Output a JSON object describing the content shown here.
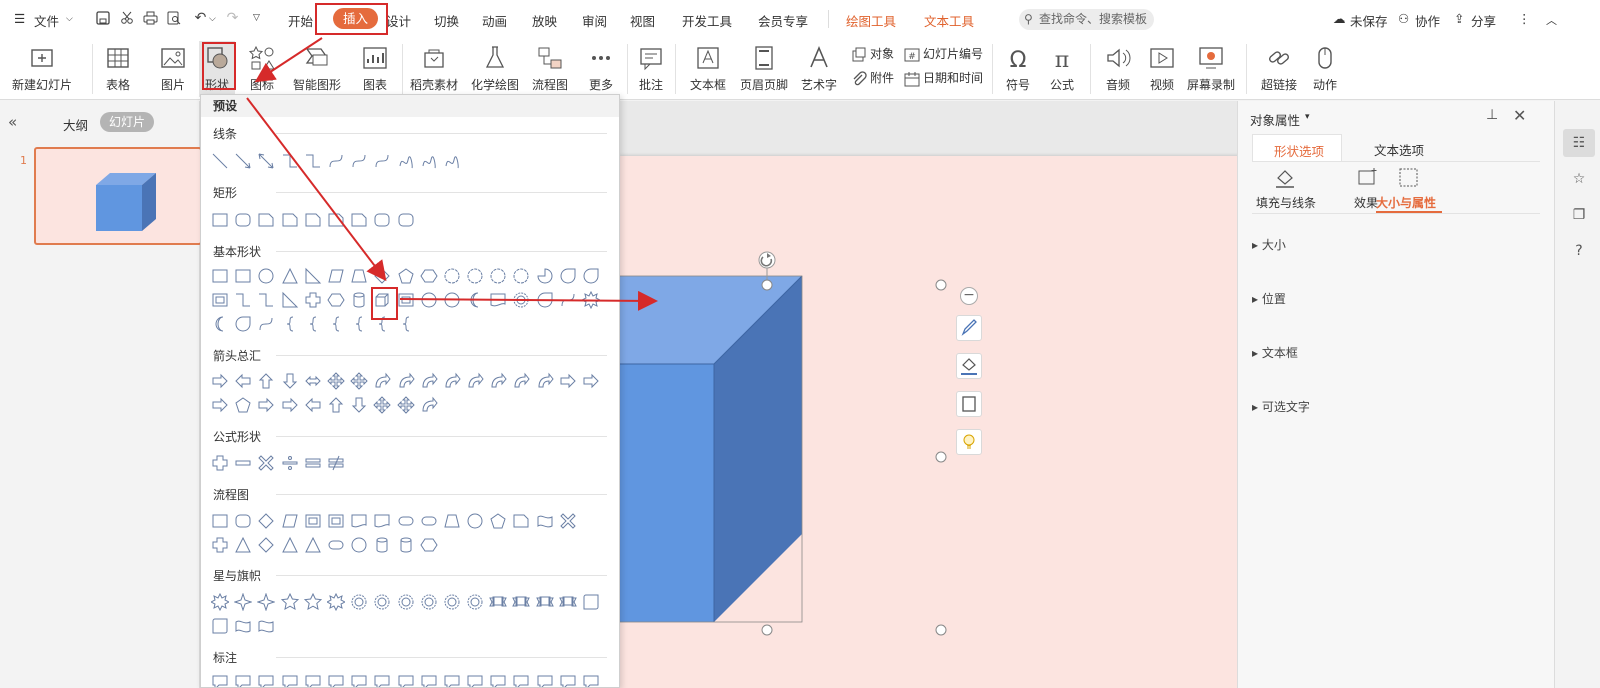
{
  "menubar": {
    "file": "文件",
    "tabs": [
      "开始",
      "插入",
      "设计",
      "切换",
      "动画",
      "放映",
      "审阅",
      "视图",
      "开发工具",
      "会员专享"
    ],
    "context_tabs": [
      "绘图工具",
      "文本工具"
    ],
    "search_placeholder": "查找命令、搜索模板",
    "unsaved": "未保存",
    "collab": "协作",
    "share": "分享"
  },
  "ribbon": {
    "new_slide": "新建幻灯片",
    "table": "表格",
    "picture": "图片",
    "shape": "形状",
    "icon": "图标",
    "smartart": "智能图形",
    "chart": "图表",
    "material": "稻壳素材",
    "chem": "化学绘图",
    "flowchart": "流程图",
    "more": "更多",
    "comment": "批注",
    "textbox": "文本框",
    "header_footer": "页眉页脚",
    "wordart": "艺术字",
    "object": "对象",
    "attachment": "附件",
    "slide_number": "幻灯片编号",
    "datetime": "日期和时间",
    "symbol": "符号",
    "formula": "公式",
    "audio": "音频",
    "video": "视频",
    "screen_record": "屏幕录制",
    "hyperlink": "超链接",
    "action": "动作"
  },
  "leftpanel": {
    "outline": "大纲",
    "slides": "幻灯片",
    "slide_num": "1"
  },
  "dropdown": {
    "header": "预设",
    "sections": [
      "线条",
      "矩形",
      "基本形状",
      "箭头总汇",
      "公式形状",
      "流程图",
      "星与旗帜",
      "标注"
    ]
  },
  "rightpanel": {
    "title": "对象属性",
    "tab_shape": "形状选项",
    "tab_text": "文本选项",
    "sub_fill": "填充与线条",
    "sub_effect": "效果",
    "sub_size": "大小与属性",
    "items": [
      "大小",
      "位置",
      "文本框",
      "可选文字"
    ]
  },
  "colors": {
    "accent": "#e56b3d",
    "cube_front": "#6096e0",
    "cube_top": "#7fa8e6",
    "cube_side": "#4a74b6",
    "slide_bg": "#fce4e0",
    "annotation_red": "#d62a2a"
  }
}
